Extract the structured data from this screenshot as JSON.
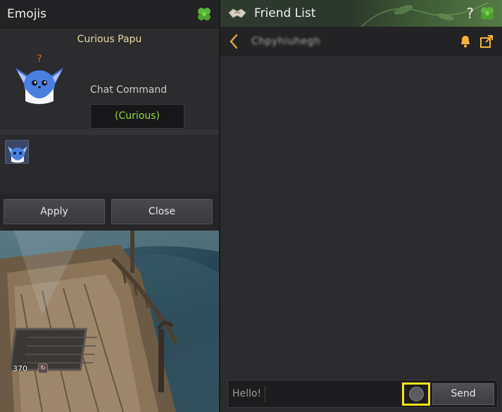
{
  "emojis_panel": {
    "title": "Emojis",
    "selected_emoji": {
      "name": "Curious Papu",
      "chat_command_label": "Chat Command",
      "chat_command": "(Curious)"
    },
    "apply_label": "Apply",
    "close_label": "Close"
  },
  "friend_panel": {
    "title": "Friend List",
    "help_symbol": "?",
    "chat_partner_name": "Chpyhiuhegh",
    "input": {
      "placeholder": "Hello!"
    },
    "send_label": "Send"
  },
  "scene": {
    "level_text": "370",
    "level_icon": "↻"
  },
  "colors": {
    "highlight": "#f2e21a",
    "command_text": "#93d83a",
    "emoji_name": "#e6d7a3"
  }
}
